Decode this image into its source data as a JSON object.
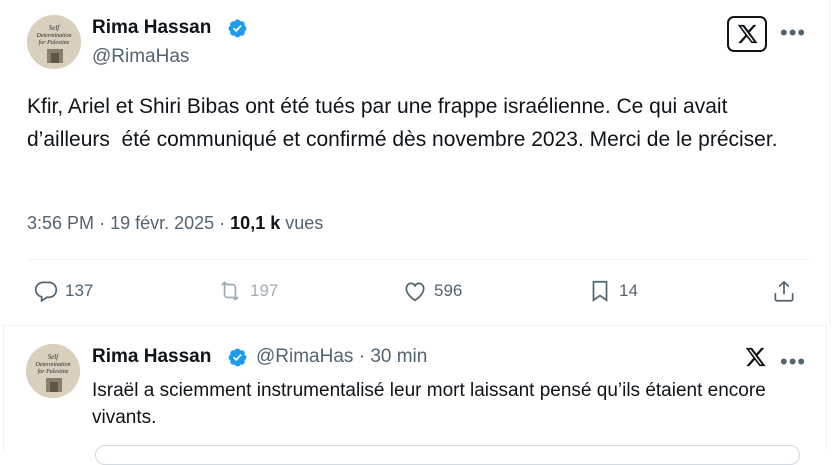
{
  "main_tweet": {
    "author": {
      "name": "Rima Hassan",
      "handle": "@RimaHas",
      "avatar_text": "Self Determination for Palestine"
    },
    "text": "Kfir, Ariel et Shiri Bibas ont été tués par une frappe israélienne. Ce qui avait d’ailleurs  été communiqué et confirmé dès novembre 2023. Merci de le préciser.",
    "time": "3:56 PM",
    "date": "19 févr. 2025",
    "views_count": "10,1 k",
    "views_label": "vues",
    "actions": {
      "replies": "137",
      "reposts": "197",
      "likes": "596",
      "bookmarks": "14"
    }
  },
  "reply_tweet": {
    "author": {
      "name": "Rima Hassan",
      "handle": "@RimaHas",
      "time_ago": "30 min",
      "avatar_text": "Self Determination for Palestine"
    },
    "text": "Israël a sciemment instrumentalisé leur mort laissant pensé qu’ils étaient encore vivants."
  },
  "colors": {
    "verified": "#1d9bf0",
    "secondary_text": "#536471",
    "primary_text": "#0f1419",
    "divider": "#eff3f4"
  }
}
